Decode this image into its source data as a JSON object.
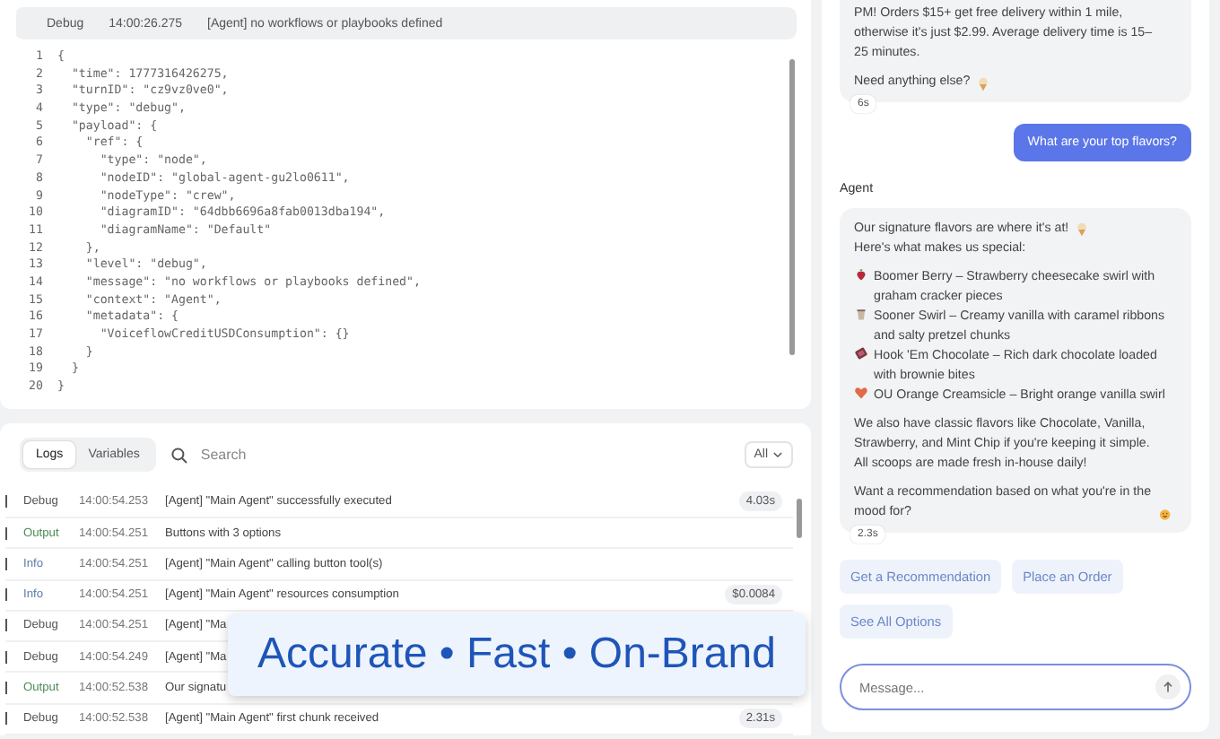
{
  "event_header": {
    "level": "Debug",
    "time": "14:00:26.275",
    "message": "[Agent] no workflows or playbooks defined"
  },
  "code_view": {
    "numbers": [
      "1",
      "2",
      "3",
      "4",
      "5",
      "6",
      "7",
      "8",
      "9",
      "10",
      "11",
      "12",
      "13",
      "14",
      "15",
      "16",
      "17",
      "18",
      "19",
      "20"
    ],
    "lines": [
      "{",
      "  \"time\": 1777316426275,",
      "  \"turnID\": \"cz9vz0ve0\",",
      "  \"type\": \"debug\",",
      "  \"payload\": {",
      "    \"ref\": {",
      "      \"type\": \"node\",",
      "      \"nodeID\": \"global-agent-gu2lo0611\",",
      "      \"nodeType\": \"crew\",",
      "      \"diagramID\": \"64dbb6696a8fab0013dba194\",",
      "      \"diagramName\": \"Default\"",
      "    },",
      "    \"level\": \"debug\",",
      "    \"message\": \"no workflows or playbooks defined\",",
      "    \"context\": \"Agent\",",
      "    \"metadata\": {",
      "      \"VoiceflowCreditUSDConsumption\": {}",
      "    }",
      "  }",
      "}"
    ]
  },
  "logs": {
    "tabs": [
      {
        "label": "Logs",
        "selected": true
      },
      {
        "label": "Variables",
        "selected": false
      }
    ],
    "search": {
      "placeholder": "Search"
    },
    "filter": "All",
    "rows": [
      {
        "level": "Debug",
        "kind": "debug",
        "time": "14:00:54.253",
        "message": "[Agent] \"Main Agent\" successfully executed",
        "badge": "4.03s"
      },
      {
        "level": "Output",
        "kind": "output",
        "time": "14:00:54.251",
        "message": "Buttons with 3 options"
      },
      {
        "level": "Info",
        "kind": "info",
        "time": "14:00:54.251",
        "message": "[Agent] \"Main Agent\" calling button tool(s)"
      },
      {
        "level": "Info",
        "kind": "info",
        "time": "14:00:54.251",
        "message": "[Agent] \"Main Agent\" resources consumption",
        "badge": "$0.0084"
      },
      {
        "level": "Debug",
        "kind": "debug",
        "time": "14:00:54.251",
        "message": "[Agent] \"Ma"
      },
      {
        "level": "Debug",
        "kind": "debug",
        "time": "14:00:54.249",
        "message": "[Agent] \"Ma"
      },
      {
        "level": "Output",
        "kind": "output",
        "time": "14:00:52.538",
        "message": "Our signatu"
      },
      {
        "level": "Debug",
        "kind": "debug",
        "time": "14:00:52.538",
        "message": "[Agent] \"Main Agent\" first chunk received",
        "badge": "2.31s"
      }
    ]
  },
  "banner": {
    "text": "Accurate • Fast • On-Brand"
  },
  "chat": {
    "messages": [
      {
        "kind": "agent",
        "paragraphs": [
          {
            "text": "PM! Orders $15+ get free delivery within 1 mile, otherwise it's just $2.99. Average delivery time is 15–25 minutes."
          },
          {
            "text": "Need anything else?",
            "trailing_icon": true
          }
        ],
        "duration": "6s"
      },
      {
        "kind": "user",
        "paragraphs": [
          {
            "text": "What are your top flavors?"
          }
        ]
      },
      {
        "kind": "agent",
        "sender": "Agent",
        "paragraphs": [
          {
            "text": "Our signature flavors are where it's at!",
            "trailing_icon": true,
            "after": "Here's what makes us special:"
          },
          {
            "items": [
              "Boomer Berry – Strawberry cheesecake swirl with graham cracker pieces",
              "Sooner Swirl – Creamy vanilla with caramel ribbons and salty pretzel chunks",
              "Hook 'Em Chocolate – Rich dark chocolate loaded with brownie bites",
              "OU Orange Creamsicle – Bright orange vanilla swirl"
            ]
          },
          {
            "text": "We also have classic flavors like Chocolate, Vanilla, Strawberry, and Mint Chip if you're keeping it simple. All scoops are made fresh in-house daily!"
          },
          {
            "text": "Want a recommendation based on what you're in the mood for?",
            "trailing_icon": true
          }
        ],
        "duration": "2.3s"
      }
    ],
    "quick_replies": [
      "Get a Recommendation",
      "Place an Order",
      "See All Options"
    ],
    "input": {
      "placeholder": "Message..."
    }
  }
}
